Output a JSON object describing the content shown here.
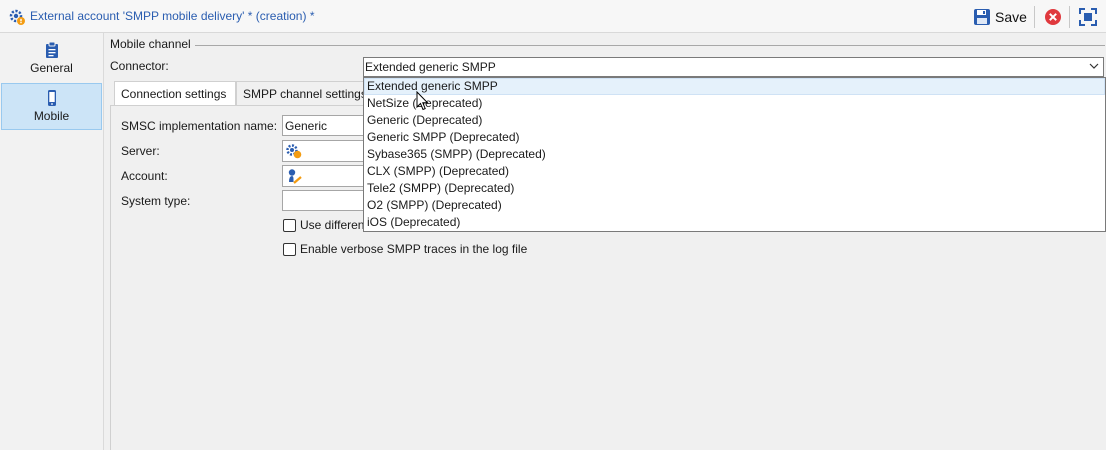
{
  "window": {
    "title": "External account 'SMPP mobile delivery' * (creation) *",
    "save_label": "Save"
  },
  "sidebar": {
    "items": [
      {
        "label": "General",
        "icon": "clipboard-icon",
        "selected": false
      },
      {
        "label": "Mobile",
        "icon": "mobile-phone-icon",
        "selected": true
      }
    ]
  },
  "main": {
    "group_label": "Mobile channel",
    "connector_label": "Connector:",
    "connector_value": "Extended generic SMPP",
    "tabs": [
      {
        "label": "Connection settings",
        "active": true
      },
      {
        "label": "SMPP channel settings",
        "active": false
      }
    ],
    "fields": {
      "smsc_label": "SMSC implementation name:",
      "smsc_value": "Generic",
      "server_label": "Server:",
      "account_label": "Account:",
      "system_type_label": "System type:"
    },
    "checkboxes": [
      {
        "label": "Use different",
        "checked": false
      },
      {
        "label": "Enable verbose SMPP traces in the log file",
        "checked": false
      }
    ]
  },
  "dropdown": {
    "options": [
      "Extended generic SMPP",
      "NetSize (Deprecated)",
      "Generic (Deprecated)",
      "Generic SMPP (Deprecated)",
      "Sybase365 (SMPP) (Deprecated)",
      "CLX (SMPP) (Deprecated)",
      "Tele2 (SMPP) (Deprecated)",
      "O2 (SMPP) (Deprecated)",
      "iOS (Deprecated)"
    ],
    "highlighted_index": 0
  },
  "colors": {
    "title_blue": "#2a5db0",
    "selected_nav": "#cce4f7",
    "close_red": "#e0393e"
  }
}
